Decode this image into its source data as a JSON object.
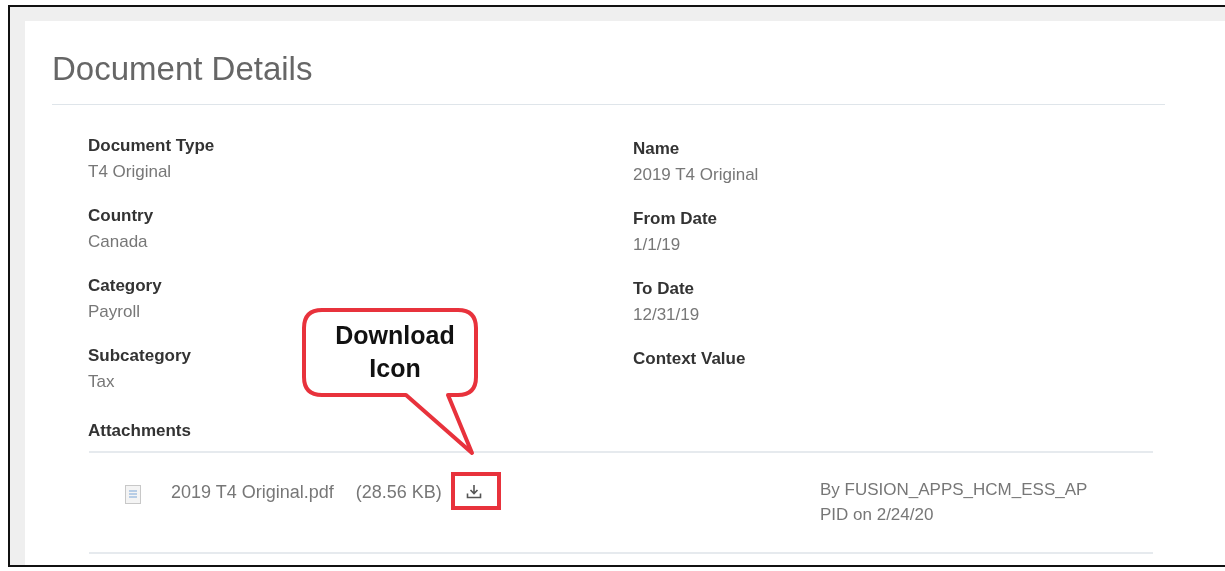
{
  "panel": {
    "title": "Document Details"
  },
  "left_fields": [
    {
      "label": "Document Type",
      "value": "T4 Original"
    },
    {
      "label": "Country",
      "value": "Canada"
    },
    {
      "label": "Category",
      "value": "Payroll"
    },
    {
      "label": "Subcategory",
      "value": "Tax"
    }
  ],
  "right_fields": [
    {
      "label": "Name",
      "value": "2019 T4 Original"
    },
    {
      "label": "From Date",
      "value": "1/1/19"
    },
    {
      "label": "To Date",
      "value": "12/31/19"
    },
    {
      "label": "Context Value"
    }
  ],
  "attachments": {
    "label": "Attachments",
    "items": [
      {
        "file_name": "2019 T4 Original.pdf",
        "size": "(28.56 KB)",
        "byline": [
          "By FUSION_APPS_HCM_ESS_AP",
          "PID on 2/24/20"
        ]
      }
    ]
  },
  "callout": {
    "text": "Download Icon"
  }
}
